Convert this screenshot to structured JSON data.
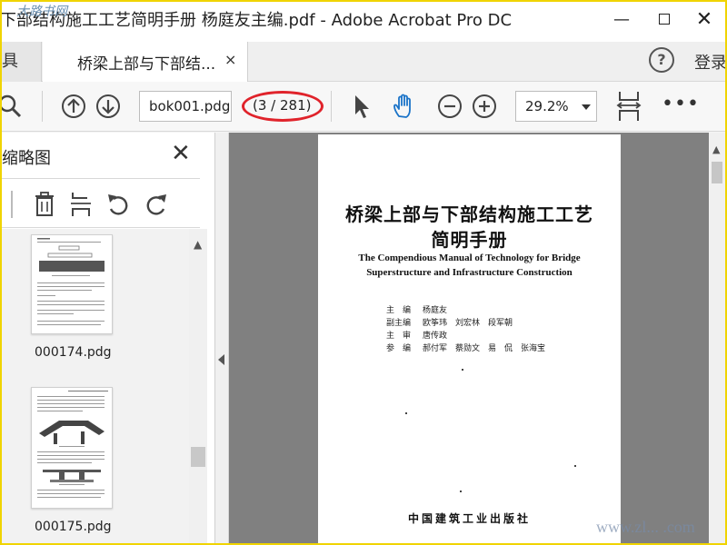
{
  "window": {
    "title": "下部结构施工工艺简明手册  杨庭友主编.pdf - Adobe Acrobat Pro DC",
    "watermark_logo": "大路书网",
    "min_glyph": "—",
    "close_glyph": "✕"
  },
  "tabs": {
    "tools_partial": "具",
    "active_label": "桥梁上部与下部结...",
    "close_glyph": "×",
    "help_glyph": "?",
    "login": "登录"
  },
  "toolbar": {
    "page_input": "bok001.pdg",
    "page_count": "(3 / 281)",
    "zoom": "29.2%",
    "more": "•••"
  },
  "sidebar": {
    "title": "缩略图",
    "close_glyph": "✕",
    "thumbnails": [
      {
        "label": "000174.pdg"
      },
      {
        "label": "000175.pdg"
      }
    ]
  },
  "document": {
    "title_line1": "桥梁上部与下部结构施工工艺",
    "title_line2": "简明手册",
    "en_line1": "The Compendious Manual of Technology for Bridge",
    "en_line2": "Superstructure and Infrastructure Construction",
    "credits": [
      {
        "role": "主　编",
        "names": "杨庭友"
      },
      {
        "role": "副主编",
        "names": "欧筝玮　刘宏林　段军朝"
      },
      {
        "role": "主　审",
        "names": "唐传政"
      },
      {
        "role": "参　编",
        "names": "郝付军　蔡勋文　易　侃　张海宝"
      }
    ],
    "publisher": "中国建筑工业出版社"
  },
  "watermark": "www.zl... .com",
  "colors": {
    "frame": "#f0d400",
    "highlight_ellipse": "#e0232b",
    "hand_tool": "#1a73c8",
    "viewer_bg": "#808080"
  }
}
